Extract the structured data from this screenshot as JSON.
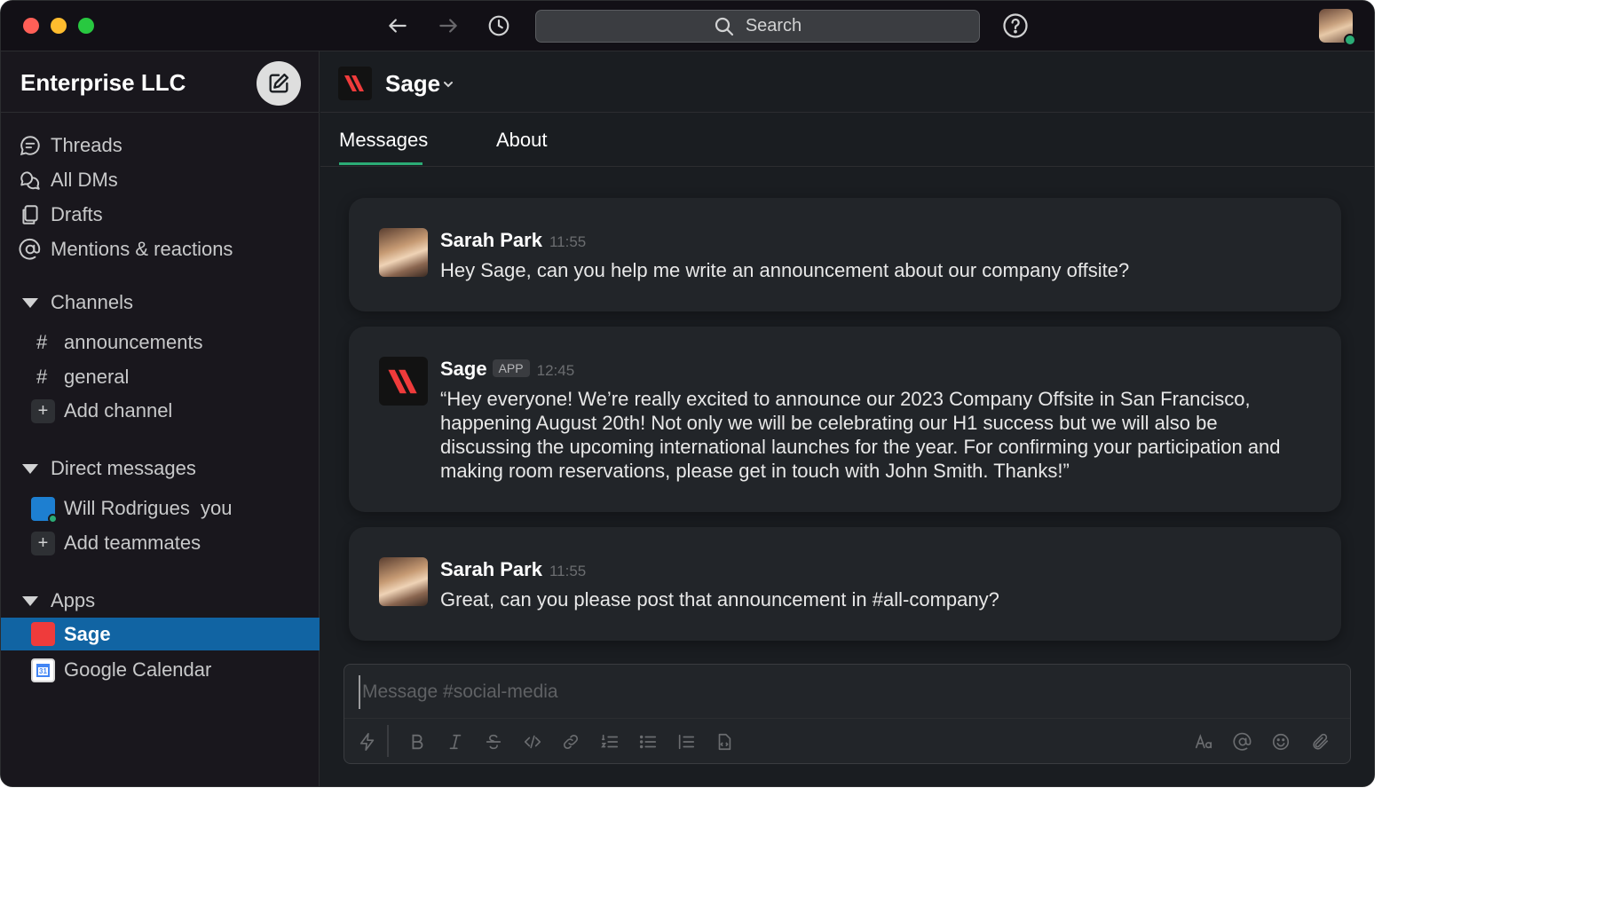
{
  "titlebar": {
    "search_placeholder": "Search"
  },
  "sidebar": {
    "workspace_name": "Enterprise LLC",
    "nav": [
      {
        "label": "Threads",
        "icon": "threads-icon"
      },
      {
        "label": "All DMs",
        "icon": "dms-icon"
      },
      {
        "label": "Drafts",
        "icon": "drafts-icon"
      },
      {
        "label": "Mentions & reactions",
        "icon": "mention-icon"
      }
    ],
    "channels": {
      "title": "Channels",
      "items": [
        "announcements",
        "general"
      ],
      "add_label": "Add channel"
    },
    "dms": {
      "title": "Direct messages",
      "items": [
        "Will Rodrigues  you"
      ],
      "add_label": "Add teammates"
    },
    "apps": {
      "title": "Apps",
      "items": [
        "Sage",
        "Google Calendar"
      ],
      "gcal_day": "31"
    }
  },
  "channel": {
    "name": "Sage",
    "tabs": [
      "Messages",
      "About"
    ]
  },
  "messages": [
    {
      "author": "Sarah Park",
      "time": "11:55",
      "badge": "",
      "text": "Hey Sage, can you help me write an announcement about our company offsite?"
    },
    {
      "author": "Sage",
      "time": "12:45",
      "badge": "APP",
      "text": "“Hey everyone! We’re really excited to announce our 2023 Company Offsite in San Francisco, happening August 20th! Not only we will be celebrating our H1 success but we will also be discussing the upcoming international launches for the year. For confirming your participation and making room reservations, please get in touch with John Smith. Thanks!”"
    },
    {
      "author": "Sarah Park",
      "time": "11:55",
      "badge": "",
      "text": "Great, can you please post that announcement in #all-company?"
    }
  ],
  "composer": {
    "placeholder": "Message #social-media"
  },
  "colors": {
    "accent_active": "#1164a3",
    "tab_underline": "#2bac76",
    "presence": "#2bac76",
    "sage_red": "#ef3b3b"
  }
}
